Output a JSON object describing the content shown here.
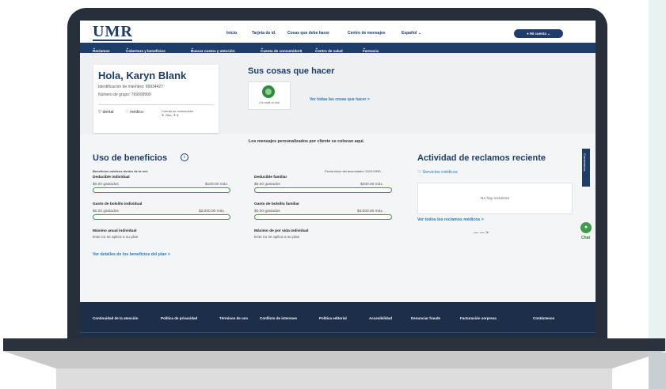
{
  "header": {
    "logo": "UMR",
    "nav": [
      "Inicio",
      "Tarjeta de id.",
      "Cosas que debe hacer",
      "Centro de mensajes",
      "Español"
    ],
    "account_label": "Mi cuenta"
  },
  "subnav": [
    "Reclamos",
    "Cobertura y beneficios",
    "Buscar costos y atención",
    "Cuenta de consumidor$",
    "Centro de salud",
    "Farmacia"
  ],
  "greeting": {
    "title": "Hola, Karyn Blank",
    "member_id": "Identificación de miembro: 99934427",
    "group": "Número de grupo: 769999999",
    "dental": "dental",
    "medical": "médico",
    "consumer_account": "Cuenta de consumidor",
    "vida": "Vida",
    "dollar": "$"
  },
  "todo": {
    "title": "Sus cosas que hacer",
    "card_text": "¡Ya está al día!",
    "link": "Ver todas las cosas que hacer >"
  },
  "message": "Los mensajes personalizados por cliente se colocan aquí.",
  "benefits": {
    "title": "Uso de beneficios",
    "in_network": "Beneficios médicos dentro de la red:",
    "accum_date": "Fecha inicio del acumulador 11/01/1990",
    "deductible_ind": {
      "label": "Deducible individual",
      "spent": "$0.00 gastados",
      "max": "$100.00 máx."
    },
    "deductible_fam": {
      "label": "Deducible familiar",
      "spent": "$0.00 gastados",
      "max": "$200.00 máx."
    },
    "oop_ind": {
      "label": "Gasto de bolsillo individual",
      "spent": "$0.00 gastados",
      "max": "$2,000.00 máx."
    },
    "oop_fam": {
      "label": "Gasto de bolsillo familiar",
      "spent": "$0.00 gastados",
      "max": "$4,000.00 máx."
    },
    "annual_ind": {
      "label": "Máximo anual individual",
      "note": "Esto no se aplica a su plan"
    },
    "lifetime_ind": {
      "label": "Máximo de por vida individual",
      "note": "Esto no se aplica a su plan"
    },
    "plan_link": "Ver detalles de los beneficios del plan >"
  },
  "claims": {
    "title": "Actividad de reclamos reciente",
    "services": "Servicios médicos",
    "empty": "No hay reclamos",
    "link": "Ver todos los reclamos médicos >",
    "pager": "— — >"
  },
  "side_tab": "Comentarios",
  "chat": "Chat",
  "footer": [
    "Continuidad de la atención",
    "Política de privacidad",
    "Términos de uso",
    "Conflicto de intereses",
    "Política editorial",
    "Accesibilidad",
    "Denunciar fraude",
    "Facturación sorpresa",
    "Contáctenos"
  ],
  "colors": {
    "navy": "#1f3d6b",
    "green": "#3e9d4a",
    "link": "#2a7ab8",
    "footer": "#1c2e4a"
  }
}
